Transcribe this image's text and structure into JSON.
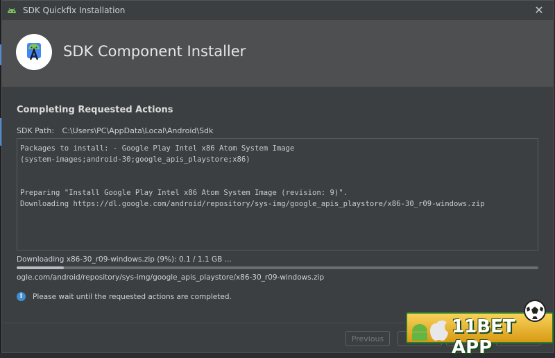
{
  "window": {
    "title": "SDK Quickfix Installation",
    "close_glyph": "✕"
  },
  "header": {
    "title": "SDK Component Installer",
    "logo_icon": "android-studio-icon"
  },
  "main": {
    "section_title": "Completing Requested Actions",
    "sdk_path_label": "SDK Path:",
    "sdk_path_value": "C:\\Users\\PC\\AppData\\Local\\Android\\Sdk",
    "log_lines": [
      "Packages to install: - Google Play Intel x86 Atom System Image",
      "(system-images;android-30;google_apis_playstore;x86)",
      "",
      "",
      "Preparing \"Install Google Play Intel x86 Atom System Image (revision: 9)\".",
      "Downloading https://dl.google.com/android/repository/sys-img/google_apis_playstore/x86-30_r09-windows.zip"
    ],
    "progress_text": "Downloading x86-30_r09-windows.zip (9%): 0.1 / 1.1 GB ...",
    "progress_percent": 9,
    "url_text": "ogle.com/android/repository/sys-img/google_apis_playstore/x86-30_r09-windows.zip",
    "info_text": "Please wait until the requested actions are completed.",
    "info_glyph": "i"
  },
  "footer": {
    "previous_label": "Previous"
  },
  "watermark": {
    "text": "11BET APP"
  },
  "colors": {
    "accent": "#3f8fd2",
    "dialog_bg": "#3c3f41",
    "header_bg": "#4e4f51"
  }
}
